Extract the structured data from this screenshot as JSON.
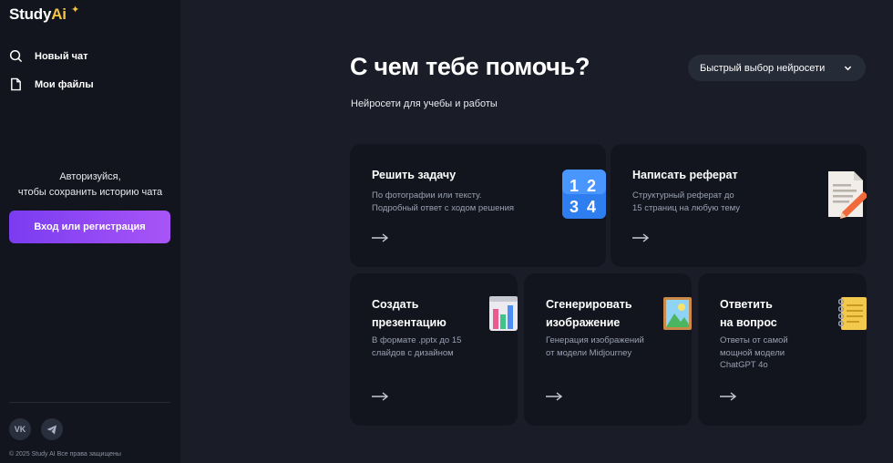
{
  "logo": {
    "text": "Study",
    "ai": "Ai"
  },
  "sidebar": {
    "new_chat": "Новый чат",
    "my_files": "Мои файлы",
    "auth_prompt_line1": "Авторизуйся,",
    "auth_prompt_line2": "чтобы сохранить историю чата",
    "login_button": "Вход или регистрация",
    "social_vk": "VK",
    "copyright": "© 2025 Study AI Все права защищены"
  },
  "main": {
    "title": "С чем тебе помочь?",
    "subtitle": "Нейросети для учебы и работы",
    "model_select": "Быстрый выбор нейросети"
  },
  "cards": [
    {
      "title": "Решить задачу",
      "desc_line1": "По фотографии или тексту.",
      "desc_line2": "Подробный ответ с ходом решения",
      "icon": "numbers-icon"
    },
    {
      "title": "Написать реферат",
      "desc_line1": "Структурный реферат до",
      "desc_line2": "15 страниц на любую тему",
      "icon": "document-pencil-icon"
    },
    {
      "title_line1": "Создать",
      "title_line2": "презентацию",
      "desc_line1": "В формате .pptx до 15",
      "desc_line2": "слайдов с дизайном",
      "icon": "bar-chart-icon"
    },
    {
      "title_line1": "Сгенерировать",
      "title_line2": "изображение",
      "desc_line1": "Генерация изображений",
      "desc_line2": "от модели Midjourney",
      "icon": "picture-icon"
    },
    {
      "title_line1": "Ответить",
      "title_line2": "на вопрос",
      "desc_line1": "Ответы от самой",
      "desc_line2": "мощной модели",
      "desc_line3": "ChatGPT 4o",
      "icon": "notepad-icon"
    }
  ],
  "colors": {
    "background": "#1a1d27",
    "sidebar": "#12151d",
    "card": "#12151d",
    "accent_start": "#7a3cf0",
    "accent_end": "#a855f7",
    "logo_ai": "#f5c542"
  }
}
